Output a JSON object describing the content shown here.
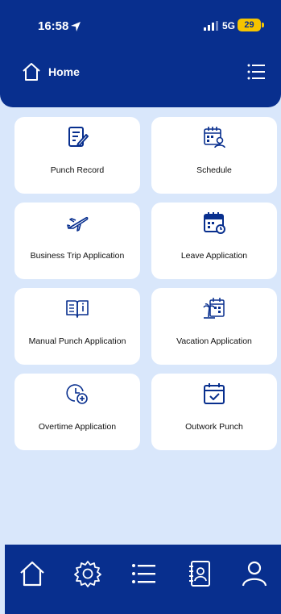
{
  "status_bar": {
    "time": "16:58",
    "network": "5G",
    "battery": "29"
  },
  "header": {
    "title": "Home"
  },
  "menu_items": [
    {
      "label": "Punch Record",
      "icon": "document-edit-icon"
    },
    {
      "label": "Schedule",
      "icon": "calendar-person-icon"
    },
    {
      "label": "Business Trip Application",
      "icon": "airplane-icon"
    },
    {
      "label": "Leave Application",
      "icon": "calendar-clock-icon"
    },
    {
      "label": "Manual Punch Application",
      "icon": "open-book-icon"
    },
    {
      "label": "Vacation Application",
      "icon": "palm-calendar-icon"
    },
    {
      "label": "Overtime Application",
      "icon": "clock-plus-icon"
    },
    {
      "label": "Outwork Punch",
      "icon": "calendar-check-icon"
    }
  ],
  "tab_bar": [
    "home-icon",
    "settings-icon",
    "list-icon",
    "contacts-icon",
    "profile-icon"
  ],
  "colors": {
    "primary": "#082f8e",
    "background": "#d9e7fb",
    "card": "#ffffff",
    "battery": "#f5c400"
  }
}
